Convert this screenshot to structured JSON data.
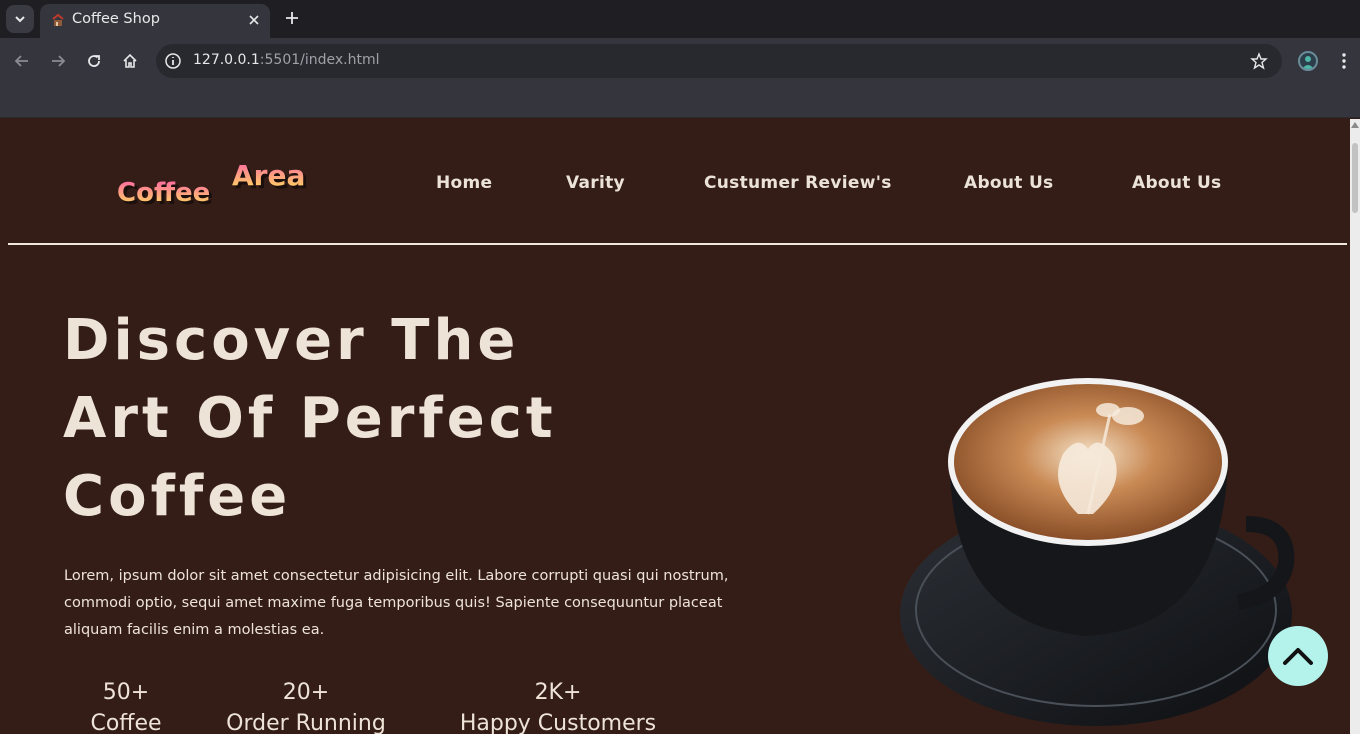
{
  "browser": {
    "tab_title": "Coffee Shop",
    "url_host": "127.0.0.1",
    "url_rest": ":5501/index.html"
  },
  "brand": {
    "logo_word1": "Coffee",
    "logo_word2": "Area"
  },
  "nav": {
    "items": [
      {
        "label": "Home"
      },
      {
        "label": "Varity"
      },
      {
        "label": "Custumer Review's"
      },
      {
        "label": "About Us"
      },
      {
        "label": "About Us"
      }
    ]
  },
  "hero": {
    "title_lines": [
      "Discover The",
      "Art Of Perfect",
      "Coffee"
    ],
    "description": "Lorem, ipsum dolor sit amet consectetur adipisicing elit. Labore corrupti quasi qui nostrum, commodi optio, sequi amet maxime fuga temporibus quis! Sapiente consequuntur placeat aliquam facilis enim a molestias ea."
  },
  "stats": [
    {
      "number": "50+",
      "label": "Coffee"
    },
    {
      "number": "20+",
      "label": "Order Running"
    },
    {
      "number": "2K+",
      "label": "Happy Customers"
    }
  ],
  "colors": {
    "page_bg": "#351d17",
    "text": "#ede3d6",
    "scroll_top_button": "#b4f2ec",
    "logo_gradient_top": "#ff5fa8",
    "logo_gradient_bottom": "#ffe15a"
  },
  "icons": {
    "scroll_top": "chevron-up-icon",
    "hero_image": "coffee-cup-illustration"
  }
}
